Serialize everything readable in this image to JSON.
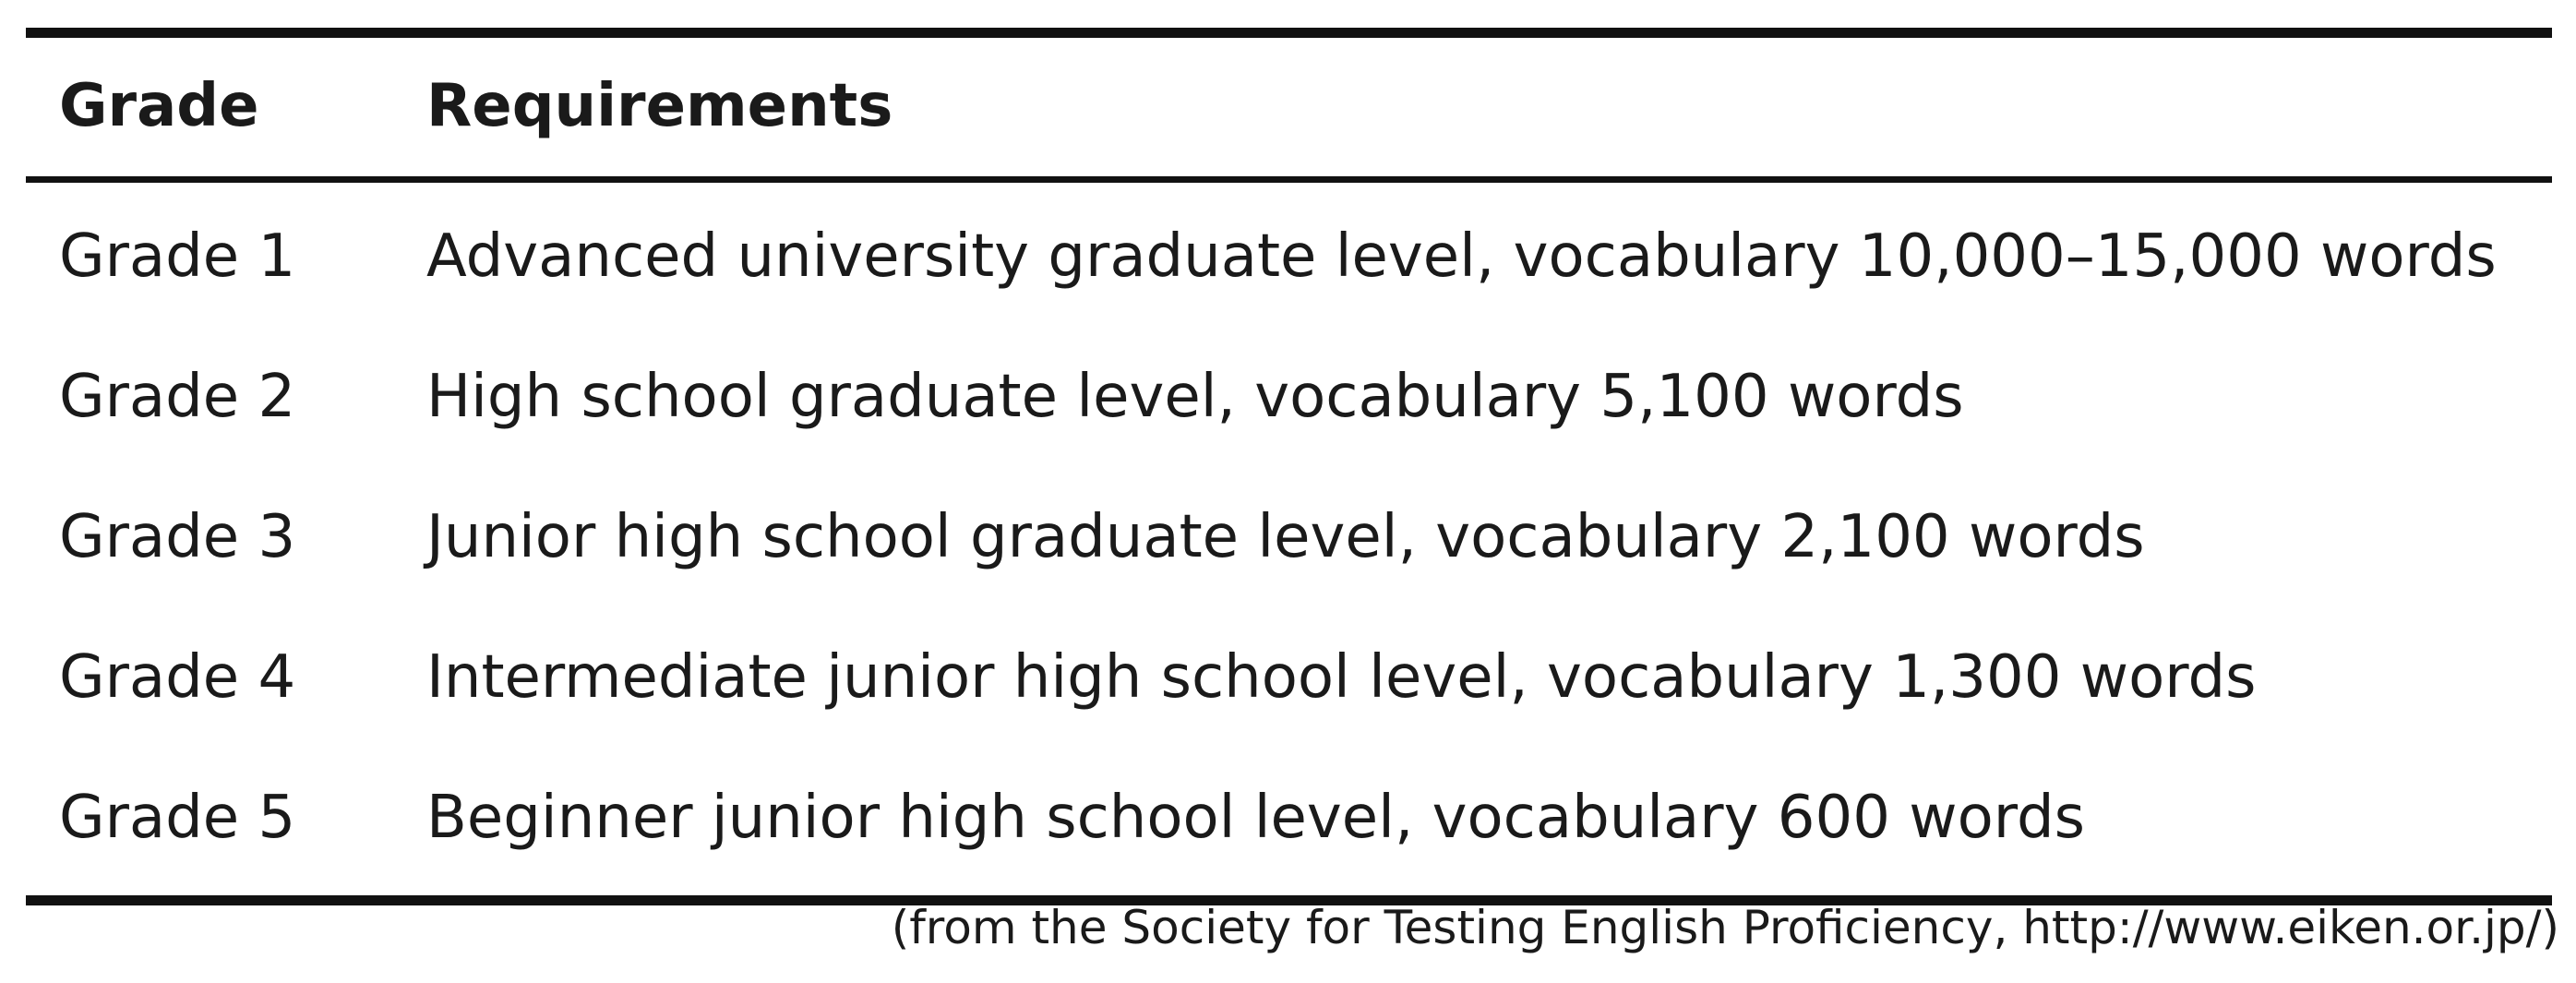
{
  "table": {
    "headers": {
      "grade": "Grade",
      "requirements": "Requirements"
    },
    "rows": [
      {
        "grade": "Grade 1",
        "requirements": "Advanced university graduate level, vocabulary 10,000–15,000 words"
      },
      {
        "grade": "Grade 2",
        "requirements": "High school graduate level, vocabulary 5,100 words"
      },
      {
        "grade": "Grade 3",
        "requirements": "Junior high school graduate level, vocabulary 2,100 words"
      },
      {
        "grade": "Grade 4",
        "requirements": "Intermediate junior high school level, vocabulary 1,300 words"
      },
      {
        "grade": "Grade 5",
        "requirements": "Beginner junior high school level, vocabulary 600 words"
      }
    ]
  },
  "source": "(from the Society for Testing English Proficiency, http://www.eiken.or.jp/)"
}
